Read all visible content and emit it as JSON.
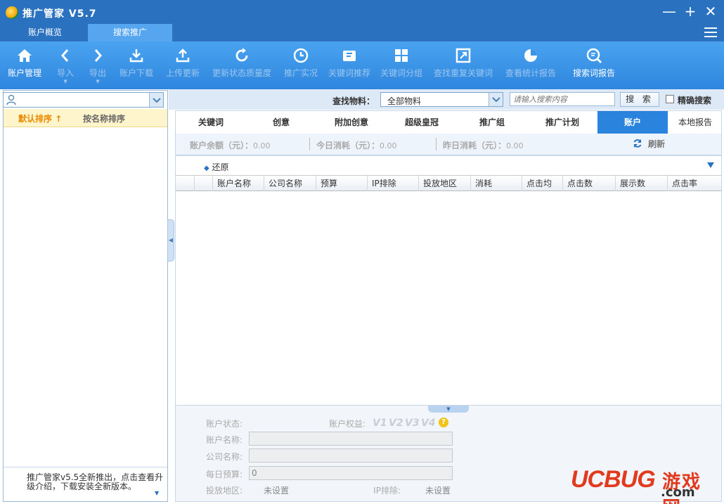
{
  "window": {
    "title": "推广管家 V5.7",
    "minimize": "—",
    "maximize": "+",
    "close": "✕"
  },
  "top_tabs": [
    {
      "label": "账户概览"
    },
    {
      "label": "搜索推广"
    }
  ],
  "toolbar": [
    {
      "label": "账户管理",
      "icon": "home-icon"
    },
    {
      "label": "导入",
      "icon": "import-icon",
      "caret": "▼"
    },
    {
      "label": "导出",
      "icon": "export-icon",
      "caret": "▼"
    },
    {
      "label": "账户下载",
      "icon": "download-icon"
    },
    {
      "label": "上传更新",
      "icon": "upload-icon"
    },
    {
      "label": "更新状态质量度",
      "icon": "refresh-icon"
    },
    {
      "label": "推广实况",
      "icon": "clock-icon"
    },
    {
      "label": "关键词推荐",
      "icon": "keyword-recommend-icon"
    },
    {
      "label": "关键词分组",
      "icon": "grid-icon"
    },
    {
      "label": "查找重复关键词",
      "icon": "duplicate-icon"
    },
    {
      "label": "查看统计报告",
      "icon": "pie-icon"
    },
    {
      "label": "搜索词报告",
      "icon": "search-term-icon"
    }
  ],
  "left": {
    "sort_default": "默认排序",
    "sort_arrow": "↑",
    "sort_by_name": "按名称排序",
    "footer_msg": "推广管家v5.5全新推出，点击查看升级介绍，下载安装全新版本。"
  },
  "find": {
    "label": "查找物料：",
    "material_value": "全部物料",
    "keyword_placeholder": "请输入搜索内容",
    "search_button": "搜 索",
    "exact_label": "精确搜索"
  },
  "main_tabs": [
    {
      "label": "关键词"
    },
    {
      "label": "创意"
    },
    {
      "label": "附加创意"
    },
    {
      "label": "超级皇冠"
    },
    {
      "label": "推广组"
    },
    {
      "label": "推广计划"
    },
    {
      "label": "账户"
    },
    {
      "label": "本地报告"
    }
  ],
  "balance": {
    "account_balance": "账户余额（元）：",
    "account_balance_value": "0.00",
    "today_cost": "今日消耗（元）：",
    "today_cost_value": "0.00",
    "yesterday_cost": "昨日消耗（元）：",
    "yesterday_cost_value": "0.00",
    "refresh": "刷新"
  },
  "grid": {
    "restore": "还原",
    "columns": [
      "",
      "",
      "账户名称",
      "公司名称",
      "预算",
      "IP排除",
      "投放地区",
      "消耗",
      "点击均",
      "点击数",
      "展示数",
      "点击率"
    ]
  },
  "details": {
    "status_label": "账户状态:",
    "rights_label": "账户权益:",
    "rights_badges": [
      "V1",
      "V2",
      "V3",
      "V4"
    ],
    "help": "?",
    "name_label": "账户名称:",
    "name_value": "",
    "company_label": "公司名称:",
    "company_value": "",
    "budget_label": "每日预算:",
    "budget_value": "0",
    "region_label": "投放地区:",
    "region_value": "未设置",
    "ip_label": "IP排除:",
    "ip_value": "未设置"
  },
  "watermark": {
    "brand": "UCBUG",
    "cn": "游戏网",
    "domain": ".com"
  },
  "colors": {
    "titlebar": "#2a72c0",
    "toolbar": "#3b95e6",
    "active_tab": "#2a83dc",
    "watermark": "#e23a1e"
  }
}
